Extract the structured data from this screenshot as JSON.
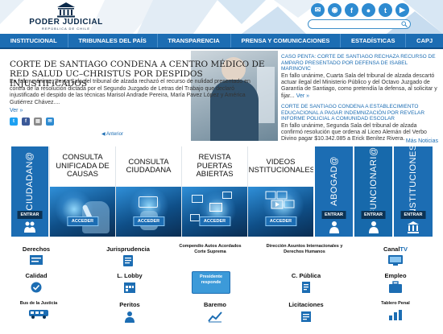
{
  "header": {
    "logo_title": "PODER JUDICIAL",
    "logo_subtitle": "REPÚBLICA DE CHILE",
    "search_placeholder": "",
    "social": [
      {
        "name": "email",
        "glyph": "✉",
        "color": "#2e8bd1"
      },
      {
        "name": "rss",
        "glyph": "◉",
        "color": "#2e8bd1"
      },
      {
        "name": "facebook",
        "glyph": "f",
        "color": "#2e8bd1"
      },
      {
        "name": "flickr",
        "glyph": "●",
        "color": "#2e8bd1"
      },
      {
        "name": "twitter",
        "glyph": "t",
        "color": "#2e8bd1"
      },
      {
        "name": "youtube",
        "glyph": "▶",
        "color": "#2e8bd1"
      }
    ]
  },
  "nav": [
    "INSTITUCIONAL",
    "TRIBUNALES DEL PAÍS",
    "TRANSPARENCIA",
    "PRENSA Y COMUNICACIONES",
    "ESTADÍSTICAS",
    "CAPJ"
  ],
  "news": {
    "main_title": "CORTE DE SANTIAGO CONDENA A CENTRO MÉDICO DE RED SALUD UC–CHRISTUS POR DESPIDOS INJUSTIFICADOS",
    "main_body": "En fallo unánime, Sexta Sala del tribunal de alzada rechazó el recurso de nulidad presentado en contra de la resolución dictada por el Segundo Juzgado de Letras del Trabajo que declaró injustificado el despido de las técnicas Marisol Andrade Pereira, María Pavez López y América Gutiérrez Chávez....",
    "more_label": "Ver »",
    "prev_label": "◀ Anterior",
    "side": [
      {
        "title": "CASO PENTA: CORTE DE SANTIAGO RECHAZA RECURSO DE AMPARO PRESENTADO POR DEFENSA DE ISABEL MARINOVIC",
        "body": "En fallo unánime, Cuarta Sala del tribunal de alzada descartó actuar ilegal del Ministerio Público y del Octavo Juzgado de Garantía de Santiago, como pretendía la defensa, al solicitar y fijar...",
        "more": "Ver »"
      },
      {
        "title": "CORTE DE SANTIAGO CONDENA A ESTABLECIMIENTO EDUCACIONAL A PAGAR INDEMNIZACIÓN POR REVELAR INFORME POLICIAL A COMUNIDAD ESCOLAR",
        "body": "En fallo unánime, Segunda Sala del tribunal de alzada confirmó resolución que ordena al Liceo Alemán del Verbo Divino pagar $10.342.085 a Erick Benítez Rivera.",
        "more": "Ver »"
      }
    ],
    "more_news": "Más Noticias"
  },
  "services": {
    "left_tab": {
      "label": "CIUDADAN@",
      "enter": "ENTRAR"
    },
    "cards": [
      {
        "title": "CONSULTA UNIFICADA DE CAUSAS",
        "button": "ACCEDER"
      },
      {
        "title": "CONSULTA CIUDADANA",
        "button": "ACCEDER"
      },
      {
        "title": "REVISTA PUERTAS ABIERTAS",
        "button": "ACCEDER"
      },
      {
        "title": "VIDEOS INSTITUCIONALES",
        "button": "ACCEDER"
      }
    ],
    "right_tabs": [
      {
        "label": "ABOGAD@",
        "enter": "ENTRAR"
      },
      {
        "label": "FUNCIONARI@",
        "enter": "ENTRAR"
      },
      {
        "label": "INSTITUCIONES",
        "enter": "ENTRAR"
      }
    ]
  },
  "links": {
    "derechos": "Derechos",
    "jurisprudencia": "Jurisprudencia",
    "compendio": "Compendio Autos Acordados Corte Suprema",
    "direccion": "Dirección Asuntos Internacionales y Derechos Humanos",
    "canal": "Canal",
    "canal_tv": "TV",
    "calidad": "Calidad",
    "lobby": "L. Lobby",
    "presidente": "Presidente responde",
    "publica": "C. Pública",
    "empleo": "Empleo",
    "bus": "Bus de la Justicia",
    "peritos": "Peritos",
    "baremo": "Baremo",
    "licitaciones": "Licitaciones",
    "tablero": "Tablero Penal"
  },
  "colors": {
    "primary": "#1c6db3",
    "dark": "#0c3253",
    "accent": "#2e8bd1"
  }
}
